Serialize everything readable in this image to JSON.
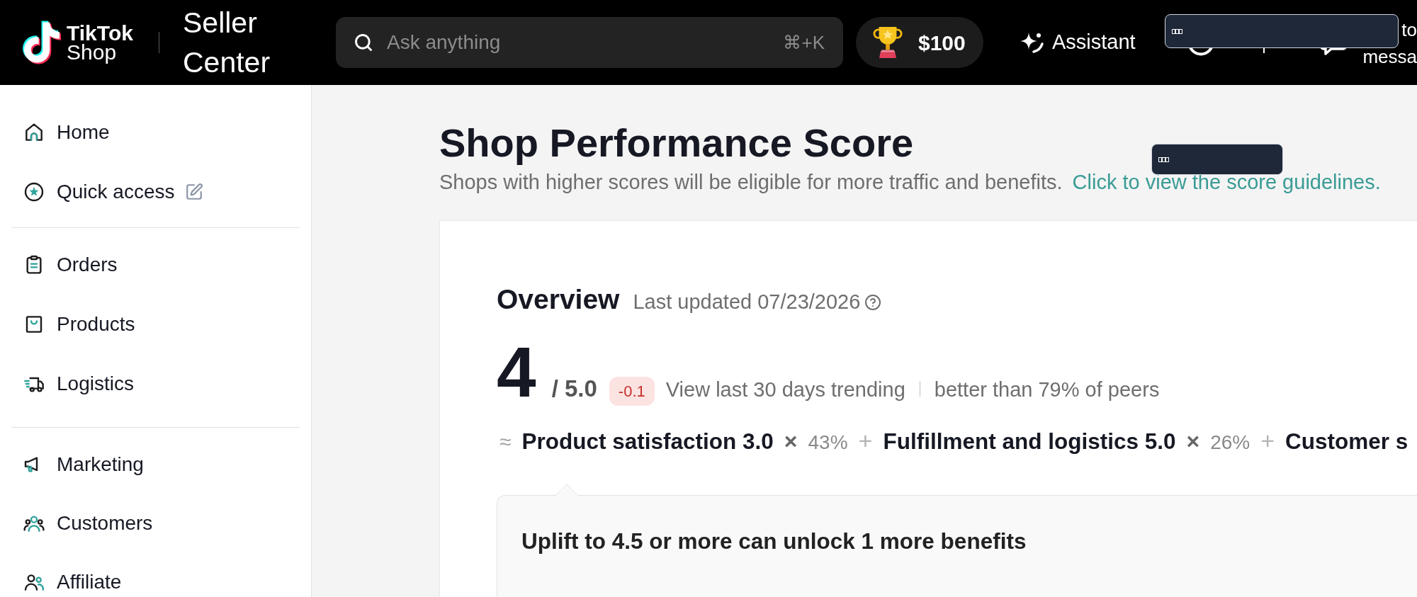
{
  "header": {
    "brand_lines": [
      "TikTok",
      "Shop"
    ],
    "product_name": "Seller Center",
    "search": {
      "placeholder": "Ask anything",
      "shortcut": "⌘+K"
    },
    "reward_amount": "$100",
    "assistant_label": "Assistant",
    "cut_off_label": [
      "to",
      "messa"
    ]
  },
  "overlays": [
    {
      "kind": "blank_tooltip"
    },
    {
      "kind": "blank_tooltip"
    }
  ],
  "sidebar": {
    "sections": [
      {
        "items": [
          {
            "label": "Home",
            "selected": false,
            "editable": false
          },
          {
            "label": "Quick access",
            "selected": false,
            "editable": true
          }
        ]
      },
      {
        "items": [
          {
            "label": "Orders",
            "selected": false,
            "editable": false
          },
          {
            "label": "Products",
            "selected": false,
            "editable": false
          },
          {
            "label": "Logistics",
            "selected": false,
            "editable": false
          }
        ]
      },
      {
        "items": [
          {
            "label": "Marketing",
            "selected": false,
            "editable": false
          },
          {
            "label": "Customers",
            "selected": false,
            "editable": false
          },
          {
            "label": "Affiliate",
            "selected": false,
            "editable": false
          }
        ]
      }
    ]
  },
  "page": {
    "title": "Shop Performance Score",
    "subtitle": "Shops with higher scores will be eligible for more traffic and benefits.",
    "guidelines_link": "Click to view the score guidelines."
  },
  "overview": {
    "title": "Overview",
    "last_updated": "Last updated 07/23/2026",
    "score": "4",
    "max_score": "/ 5.0",
    "change": "-0.1",
    "trend_link": "View last 30 days trending",
    "peer_comparison": "better than 79% of peers",
    "formula": [
      {
        "kind": "approx",
        "text": "≈"
      },
      {
        "kind": "metric",
        "text": "Product satisfaction 3.0"
      },
      {
        "kind": "times",
        "text": "×"
      },
      {
        "kind": "weight",
        "text": "43%"
      },
      {
        "kind": "plus",
        "text": "+"
      },
      {
        "kind": "metric",
        "text": "Fulfillment and logistics 5.0"
      },
      {
        "kind": "times",
        "text": "×"
      },
      {
        "kind": "weight",
        "text": "26%"
      },
      {
        "kind": "plus",
        "text": "+"
      },
      {
        "kind": "metric",
        "text": "Customer s"
      }
    ],
    "benefits_message": "Uplift to 4.5 or more can unlock 1 more benefits"
  }
}
